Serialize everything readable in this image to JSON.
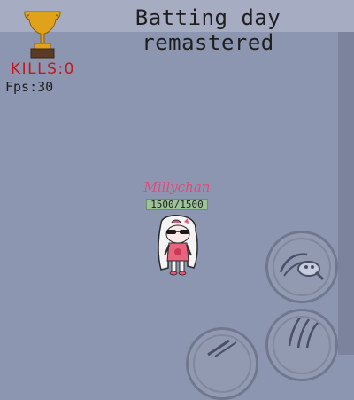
{
  "hud": {
    "title_line1": "Batting day",
    "title_line2": "remastered",
    "kills_label": "KILLS:0",
    "fps_label": "Fps:30"
  },
  "player": {
    "name": "Millychan",
    "hp_text": "1500/1500",
    "hp_fraction": 1.0
  },
  "controls": {
    "attack_icon": "bat-swing-icon",
    "skill_icon": "claw-slash-icon",
    "dash_icon": "dash-icon"
  },
  "colors": {
    "background": "#8d96b0",
    "kills_text": "#c4161c",
    "player_name": "#e04a7a",
    "trophy": "#e0a21a",
    "health_bar": "#9cc497"
  }
}
